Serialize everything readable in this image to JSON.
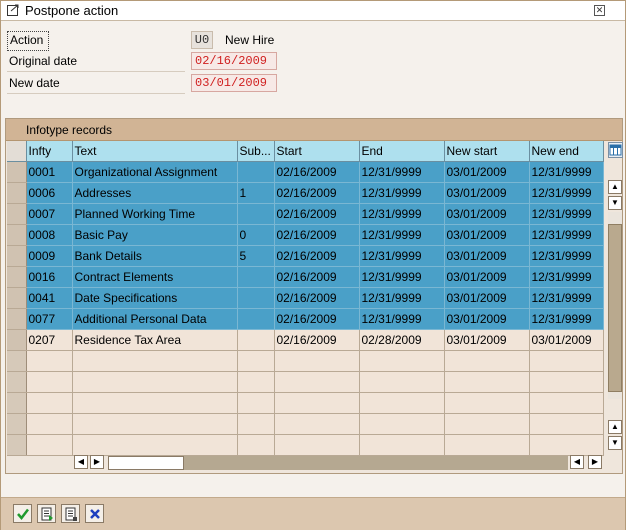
{
  "window": {
    "title": "Postpone action"
  },
  "form": {
    "action_label": "Action",
    "action_code": "U0",
    "action_text": "New Hire",
    "original_date_label": "Original date",
    "original_date": "02/16/2009",
    "new_date_label": "New date",
    "new_date": "03/01/2009"
  },
  "table": {
    "caption": "Infotype records",
    "columns": [
      "Infty",
      "Text",
      "Sub...",
      "Start",
      "End",
      "New start",
      "New end"
    ],
    "rows": [
      {
        "infty": "0001",
        "text": "Organizational Assignment",
        "sub": "",
        "start": "02/16/2009",
        "end": "12/31/9999",
        "new_start": "03/01/2009",
        "new_end": "12/31/9999",
        "selected": true
      },
      {
        "infty": "0006",
        "text": "Addresses",
        "sub": "1",
        "start": "02/16/2009",
        "end": "12/31/9999",
        "new_start": "03/01/2009",
        "new_end": "12/31/9999",
        "selected": true
      },
      {
        "infty": "0007",
        "text": "Planned Working Time",
        "sub": "",
        "start": "02/16/2009",
        "end": "12/31/9999",
        "new_start": "03/01/2009",
        "new_end": "12/31/9999",
        "selected": true
      },
      {
        "infty": "0008",
        "text": "Basic Pay",
        "sub": "0",
        "start": "02/16/2009",
        "end": "12/31/9999",
        "new_start": "03/01/2009",
        "new_end": "12/31/9999",
        "selected": true
      },
      {
        "infty": "0009",
        "text": "Bank Details",
        "sub": "5",
        "start": "02/16/2009",
        "end": "12/31/9999",
        "new_start": "03/01/2009",
        "new_end": "12/31/9999",
        "selected": true
      },
      {
        "infty": "0016",
        "text": "Contract Elements",
        "sub": "",
        "start": "02/16/2009",
        "end": "12/31/9999",
        "new_start": "03/01/2009",
        "new_end": "12/31/9999",
        "selected": true
      },
      {
        "infty": "0041",
        "text": "Date Specifications",
        "sub": "",
        "start": "02/16/2009",
        "end": "12/31/9999",
        "new_start": "03/01/2009",
        "new_end": "12/31/9999",
        "selected": true
      },
      {
        "infty": "0077",
        "text": "Additional Personal Data",
        "sub": "",
        "start": "02/16/2009",
        "end": "12/31/9999",
        "new_start": "03/01/2009",
        "new_end": "12/31/9999",
        "selected": true
      },
      {
        "infty": "0207",
        "text": "Residence Tax Area",
        "sub": "",
        "start": "02/16/2009",
        "end": "02/28/2009",
        "new_start": "03/01/2009",
        "new_end": "03/01/2009",
        "selected": false
      }
    ]
  },
  "footer": {
    "buttons": [
      "check-icon",
      "save-list-icon",
      "copy-list-icon",
      "cancel-icon"
    ]
  }
}
